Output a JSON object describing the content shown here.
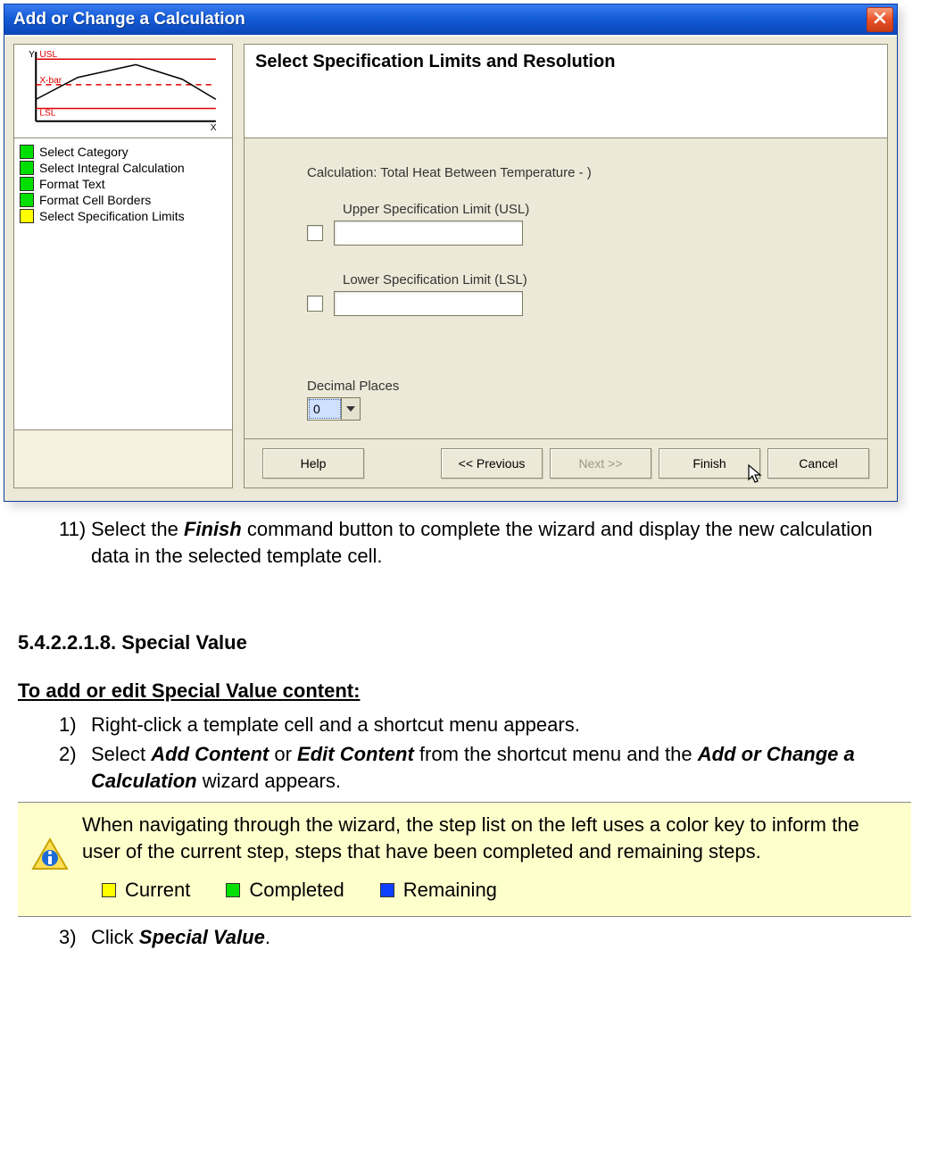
{
  "window": {
    "title": "Add or Change a Calculation",
    "heading": "Select Specification Limits and Resolution",
    "calc_prefix": "Calculation: ",
    "calc_name": "Total Heat Between Temperature - )",
    "usl_label": "Upper Specification Limit (USL)",
    "lsl_label": "Lower Specification Limit (LSL)",
    "decimal_label": "Decimal Places",
    "decimal_value": "0",
    "steps": [
      {
        "label": "Select Category",
        "state": "green"
      },
      {
        "label": "Select Integral Calculation",
        "state": "green"
      },
      {
        "label": "Format Text",
        "state": "green"
      },
      {
        "label": "Format Cell Borders",
        "state": "green"
      },
      {
        "label": "Select Specification Limits",
        "state": "yellow"
      }
    ],
    "preview_labels": {
      "y": "Y",
      "x": "X",
      "usl": "USL",
      "xbar": "X-bar",
      "lsl": "LSL"
    },
    "buttons": {
      "help": "Help",
      "prev": "<< Previous",
      "next": "Next >>",
      "finish": "Finish",
      "cancel": "Cancel"
    }
  },
  "doc": {
    "step11_num": "11)",
    "step11_a": "Select the ",
    "step11_b": "Finish",
    "step11_c": " command button to complete the wizard and display the new calculation data in the selected template cell.",
    "section_no": "5.4.2.2.1.8. Special Value",
    "subhead": "To add or edit Special Value content:",
    "s1_num": "1)",
    "s1": "Right-click a template cell and a shortcut menu appears.",
    "s2_num": "2)",
    "s2_a": "Select ",
    "s2_b": "Add Content",
    "s2_c": " or ",
    "s2_d": "Edit Content",
    "s2_e": " from the shortcut menu and the ",
    "s2_f": "Add or Change a Calculation",
    "s2_g": " wizard appears.",
    "info_text": "When navigating through the wizard, the step list on the left uses a color key to inform the user of the current step, steps that have been completed and remaining steps.",
    "legend": {
      "current": "Current",
      "completed": "Completed",
      "remaining": "Remaining"
    },
    "s3_num": "3)",
    "s3_a": "Click ",
    "s3_b": "Special Value",
    "s3_c": "."
  }
}
